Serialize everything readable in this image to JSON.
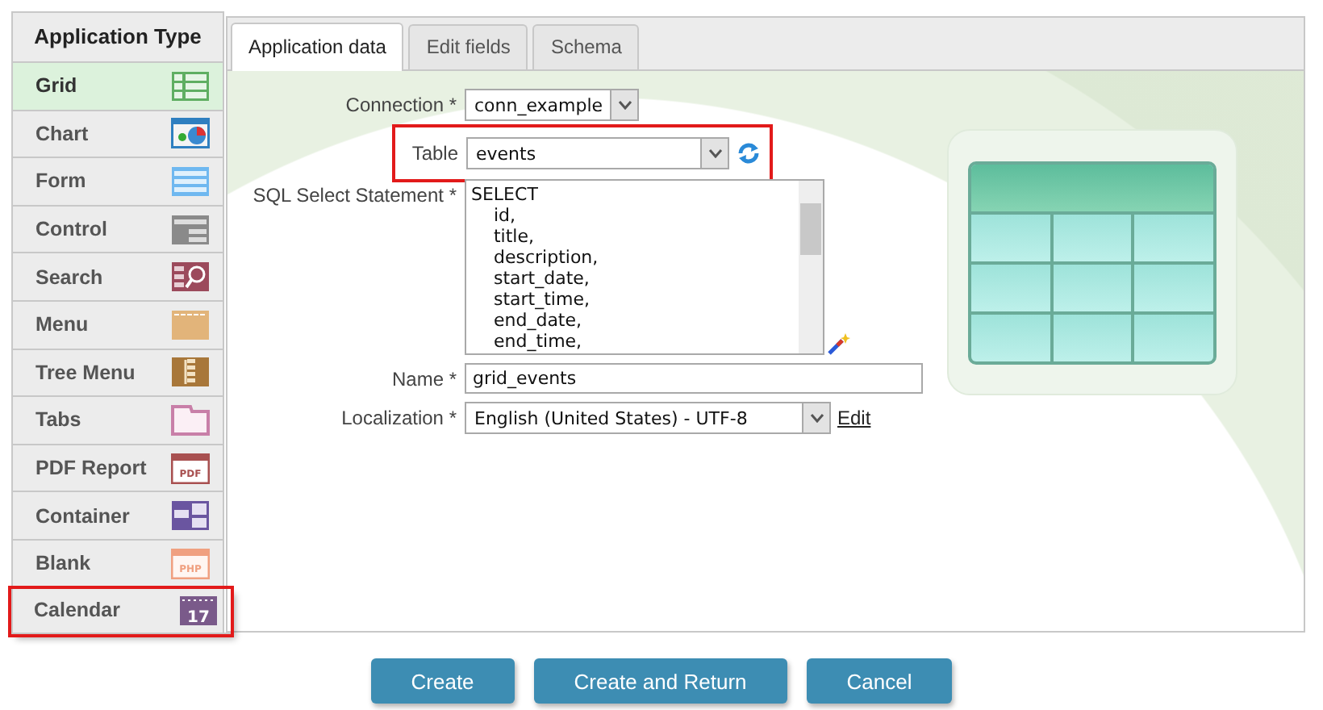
{
  "sidebar": {
    "title": "Application Type",
    "items": [
      {
        "label": "Grid",
        "kind": "grid",
        "color": "#5fae62",
        "selected": true,
        "highlighted": false
      },
      {
        "label": "Chart",
        "kind": "chart",
        "color": "#2f7fc0",
        "selected": false,
        "highlighted": false
      },
      {
        "label": "Form",
        "kind": "form",
        "color": "#6fb8f0",
        "selected": false,
        "highlighted": false
      },
      {
        "label": "Control",
        "kind": "control",
        "color": "#8a8a8a",
        "selected": false,
        "highlighted": false
      },
      {
        "label": "Search",
        "kind": "search",
        "color": "#9c4a5c",
        "selected": false,
        "highlighted": false
      },
      {
        "label": "Menu",
        "kind": "menu",
        "color": "#e2b47a",
        "selected": false,
        "highlighted": false
      },
      {
        "label": "Tree Menu",
        "kind": "tree",
        "color": "#a8773a",
        "selected": false,
        "highlighted": false
      },
      {
        "label": "Tabs",
        "kind": "tabs",
        "color": "#c87fa8",
        "selected": false,
        "highlighted": false
      },
      {
        "label": "PDF Report",
        "kind": "pdf",
        "color": "#a85050",
        "icon_text": "PDF",
        "selected": false,
        "highlighted": false
      },
      {
        "label": "Container",
        "kind": "container",
        "color": "#6a55a0",
        "selected": false,
        "highlighted": false
      },
      {
        "label": "Blank",
        "kind": "blank",
        "color": "#f0a080",
        "icon_text": "PHP",
        "selected": false,
        "highlighted": false
      },
      {
        "label": "Calendar",
        "kind": "calendar",
        "color": "#7a5a8a",
        "icon_text": "17",
        "selected": false,
        "highlighted": true
      }
    ]
  },
  "tabs": [
    {
      "label": "Application data",
      "selected": true
    },
    {
      "label": "Edit fields",
      "selected": false
    },
    {
      "label": "Schema",
      "selected": false
    }
  ],
  "form": {
    "connection": {
      "label": "Connection *",
      "value": "conn_example"
    },
    "table": {
      "label": "Table",
      "value": "events",
      "highlighted": true
    },
    "sql": {
      "label": "SQL Select Statement *",
      "lines": [
        "SELECT",
        "    id,",
        "    title,",
        "    description,",
        "    start_date,",
        "    start_time,",
        "    end_date,",
        "    end_time,"
      ]
    },
    "name": {
      "label": "Name *",
      "value": "grid_events"
    },
    "localization": {
      "label": "Localization *",
      "value": "English (United States) - UTF-8",
      "link": "Edit"
    }
  },
  "buttons": [
    "Create",
    "Create and Return",
    "Cancel"
  ]
}
